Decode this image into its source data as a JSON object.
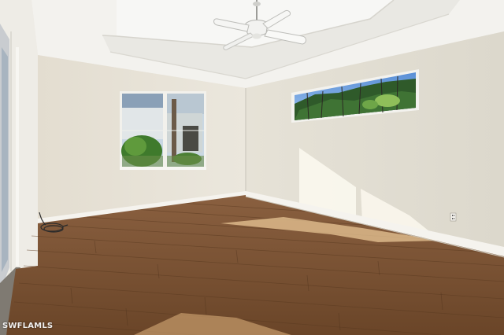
{
  "watermark": {
    "text": "SWFLAMLS"
  },
  "scene": {
    "description_icons": [
      "ceiling-fan-icon",
      "electrical-outlet-icon"
    ],
    "colors": {
      "ceiling": "#f5f4f0",
      "left_wall": "#e7e2d6",
      "right_wall": "#e3dfd4",
      "floor_dark": "#6d4a2c",
      "floor_light": "#a8794d",
      "baseboard": "#f4f2ec",
      "sunlight": "#fbf7ea"
    }
  }
}
